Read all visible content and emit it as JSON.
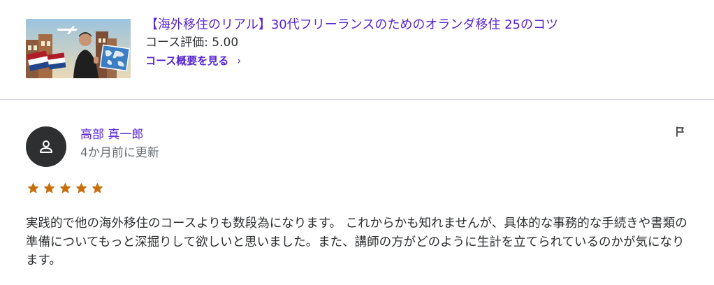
{
  "course": {
    "title": "【海外移住のリアル】30代フリーランスのためのオランダ移住 25のコツ",
    "rating_text": "コース評価: 5.00",
    "link_label": "コース概要を見る",
    "link_chevron": "›",
    "thumbnail_icons": [
      "airplane-icon",
      "netherlands-flag-icon",
      "world-map-icon",
      "person-icon"
    ]
  },
  "review": {
    "reviewer_name": "高部 真一郎",
    "updated": "4か月前に更新",
    "rating": 5,
    "rating_max": 5,
    "body": "実践的で他の海外移住のコースよりも数段為になります。 これからかも知れませんが、具体的な事務的な手続きや書類の準備についてもっと深掘りして欲しいと思いました。また、講師の方がどのように生計を立てられているのかが気になります。",
    "avatar_icon": "user-icon",
    "report_icon": "flag-icon"
  },
  "colors": {
    "brand_purple": "#5624d0",
    "star_orange": "#c4710d",
    "avatar_bg": "#2d2f31",
    "divider": "#d1d2e0",
    "muted_text": "#6a6f73"
  }
}
